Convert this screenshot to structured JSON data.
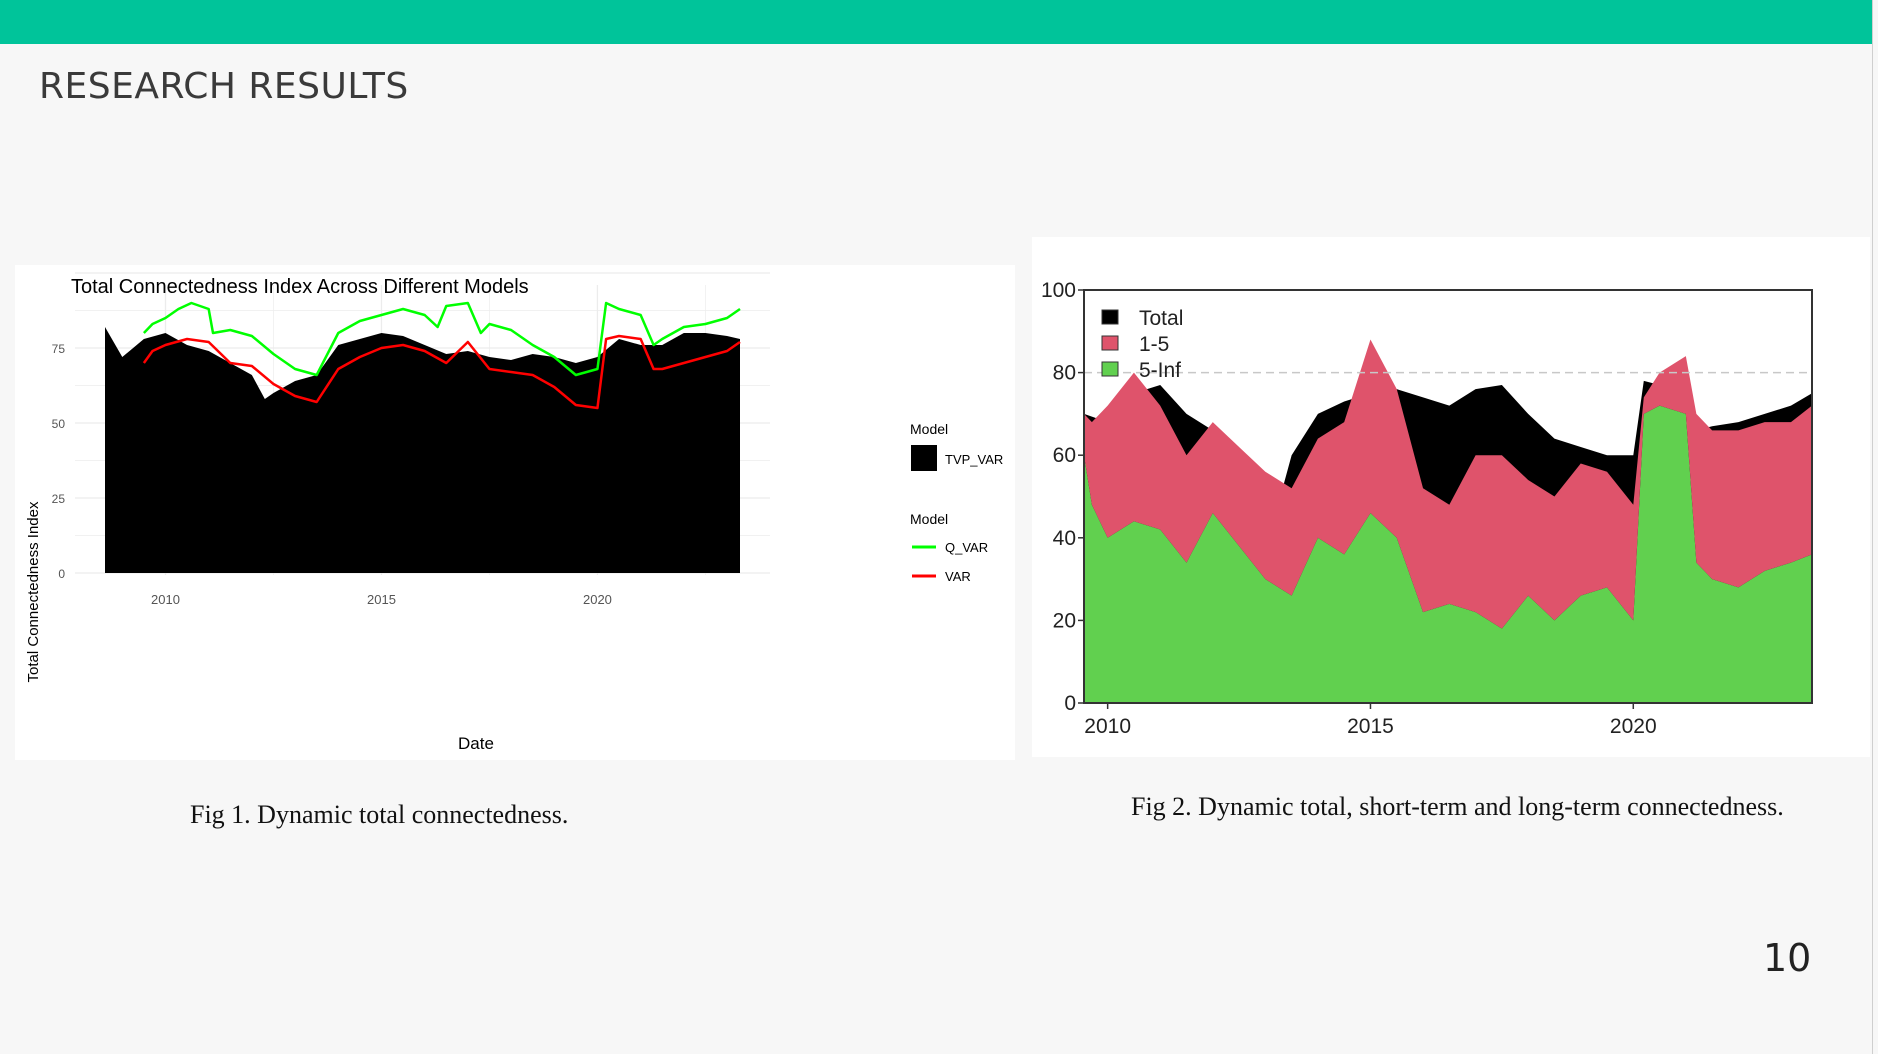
{
  "slide": {
    "title": "RESEARCH RESULTS",
    "page_number": "10",
    "accent_color": "#00c49a",
    "caption1": "Fig 1. Dynamic total connectedness.",
    "caption2": "Fig 2. Dynamic total, short-term and long-term connectedness."
  },
  "chart_data": [
    {
      "type": "area",
      "title": "Total Connectedness Index Across Different Models",
      "xlabel": "Date",
      "ylabel": "Total Connectedness Index",
      "xlim": [
        2008.6,
        2023.3
      ],
      "ylim": [
        0,
        100
      ],
      "x_ticks": [
        "2010",
        "2015",
        "2020"
      ],
      "y_ticks": [
        "0",
        "25",
        "50",
        "75"
      ],
      "grid": true,
      "legend_position": "right",
      "legend": [
        {
          "title": "Model",
          "label": "TVP_VAR",
          "color": "#000000"
        },
        {
          "title": "Model",
          "label": "Q_VAR",
          "color": "#00ff00"
        },
        {
          "title": "Model",
          "label": "VAR",
          "color": "#ff0000"
        }
      ],
      "series": [
        {
          "name": "TVP_VAR",
          "kind": "area",
          "color": "#000000",
          "x": [
            2008.6,
            2009.0,
            2009.5,
            2010.0,
            2010.5,
            2011.0,
            2011.5,
            2012.0,
            2012.3,
            2012.5,
            2013.0,
            2013.5,
            2014.0,
            2014.5,
            2015.0,
            2015.5,
            2016.0,
            2016.5,
            2017.0,
            2017.5,
            2018.0,
            2018.5,
            2019.0,
            2019.5,
            2020.0,
            2020.5,
            2021.0,
            2021.5,
            2022.0,
            2022.5,
            2023.0,
            2023.3
          ],
          "values": [
            82,
            72,
            78,
            80,
            76,
            74,
            70,
            66,
            58,
            60,
            64,
            66,
            76,
            78,
            80,
            79,
            76,
            73,
            74,
            72,
            71,
            73,
            72,
            70,
            72,
            78,
            76,
            76,
            80,
            80,
            79,
            78
          ]
        },
        {
          "name": "Q_VAR",
          "kind": "line",
          "color": "#00ff00",
          "x": [
            2009.5,
            2009.7,
            2010.0,
            2010.3,
            2010.6,
            2011.0,
            2011.1,
            2011.5,
            2012.0,
            2012.5,
            2013.0,
            2013.5,
            2014.0,
            2014.5,
            2015.0,
            2015.5,
            2016.0,
            2016.3,
            2016.5,
            2017.0,
            2017.3,
            2017.5,
            2018.0,
            2018.5,
            2019.0,
            2019.5,
            2020.0,
            2020.2,
            2020.5,
            2021.0,
            2021.3,
            2021.5,
            2022.0,
            2022.5,
            2023.0,
            2023.3
          ],
          "values": [
            80,
            83,
            85,
            88,
            90,
            88,
            80,
            81,
            79,
            73,
            68,
            66,
            80,
            84,
            86,
            88,
            86,
            82,
            89,
            90,
            80,
            83,
            81,
            76,
            72,
            66,
            68,
            90,
            88,
            86,
            76,
            78,
            82,
            83,
            85,
            88
          ]
        },
        {
          "name": "VAR",
          "kind": "line",
          "color": "#ff0000",
          "x": [
            2009.5,
            2009.7,
            2010.0,
            2010.5,
            2011.0,
            2011.5,
            2012.0,
            2012.5,
            2013.0,
            2013.5,
            2014.0,
            2014.5,
            2015.0,
            2015.5,
            2016.0,
            2016.5,
            2017.0,
            2017.5,
            2018.0,
            2018.5,
            2019.0,
            2019.5,
            2020.0,
            2020.2,
            2020.5,
            2021.0,
            2021.3,
            2021.5,
            2022.0,
            2022.5,
            2023.0,
            2023.3
          ],
          "values": [
            70,
            74,
            76,
            78,
            77,
            70,
            69,
            63,
            59,
            57,
            68,
            72,
            75,
            76,
            74,
            70,
            77,
            68,
            67,
            66,
            62,
            56,
            55,
            78,
            79,
            78,
            68,
            68,
            70,
            72,
            74,
            77
          ]
        }
      ]
    },
    {
      "type": "area",
      "title": "",
      "xlabel": "",
      "ylabel": "",
      "xlim": [
        2009.55,
        2023.4
      ],
      "ylim": [
        0,
        100
      ],
      "x_ticks": [
        "2010",
        "2015",
        "2020"
      ],
      "y_ticks": [
        "0",
        "20",
        "40",
        "60",
        "80",
        "100"
      ],
      "reference_line": 80,
      "legend_position": "top-left",
      "legend": [
        {
          "label": "Total",
          "color": "#000000"
        },
        {
          "label": "1-5",
          "color": "#df536b"
        },
        {
          "label": "5-Inf",
          "color": "#61d04f"
        }
      ],
      "series": [
        {
          "name": "Total",
          "color": "#000000",
          "x": [
            2009.55,
            2010.0,
            2010.5,
            2011.0,
            2011.5,
            2012.0,
            2012.5,
            2013.0,
            2013.2,
            2013.5,
            2014.0,
            2014.5,
            2015.0,
            2015.5,
            2016.0,
            2016.5,
            2017.0,
            2017.5,
            2018.0,
            2018.5,
            2019.0,
            2019.5,
            2020.0,
            2020.2,
            2020.5,
            2021.0,
            2021.2,
            2021.5,
            2022.0,
            2022.5,
            2023.0,
            2023.4
          ],
          "values": [
            70,
            68,
            75,
            77,
            70,
            66,
            58,
            54,
            46,
            60,
            70,
            73,
            75,
            76,
            74,
            72,
            76,
            77,
            70,
            64,
            62,
            60,
            60,
            78,
            77,
            72,
            66,
            67,
            68,
            70,
            72,
            75
          ]
        },
        {
          "name": "5-Inf",
          "color": "#61d04f",
          "x": [
            2009.55,
            2009.7,
            2010.0,
            2010.5,
            2011.0,
            2011.5,
            2012.0,
            2012.5,
            2013.0,
            2013.5,
            2014.0,
            2014.5,
            2015.0,
            2015.5,
            2016.0,
            2016.5,
            2017.0,
            2017.5,
            2018.0,
            2018.5,
            2019.0,
            2019.5,
            2020.0,
            2020.2,
            2020.5,
            2021.0,
            2021.2,
            2021.5,
            2022.0,
            2022.5,
            2023.0,
            2023.4
          ],
          "values": [
            60,
            48,
            40,
            44,
            42,
            34,
            46,
            38,
            30,
            26,
            40,
            36,
            46,
            40,
            22,
            24,
            22,
            18,
            26,
            20,
            26,
            28,
            20,
            70,
            72,
            70,
            34,
            30,
            28,
            32,
            34,
            36
          ]
        },
        {
          "name": "1-5",
          "color": "#df536b",
          "x": [
            2009.55,
            2009.7,
            2010.0,
            2010.5,
            2011.0,
            2011.5,
            2012.0,
            2012.5,
            2013.0,
            2013.5,
            2014.0,
            2014.5,
            2015.0,
            2015.5,
            2016.0,
            2016.5,
            2017.0,
            2017.5,
            2018.0,
            2018.5,
            2019.0,
            2019.5,
            2020.0,
            2020.2,
            2020.5,
            2021.0,
            2021.2,
            2021.5,
            2022.0,
            2022.5,
            2023.0,
            2023.4
          ],
          "values": [
            10,
            20,
            32,
            36,
            30,
            26,
            22,
            24,
            26,
            26,
            24,
            32,
            42,
            36,
            30,
            24,
            38,
            42,
            28,
            30,
            32,
            28,
            28,
            4,
            8,
            14,
            36,
            36,
            38,
            36,
            34,
            36
          ]
        }
      ]
    }
  ]
}
